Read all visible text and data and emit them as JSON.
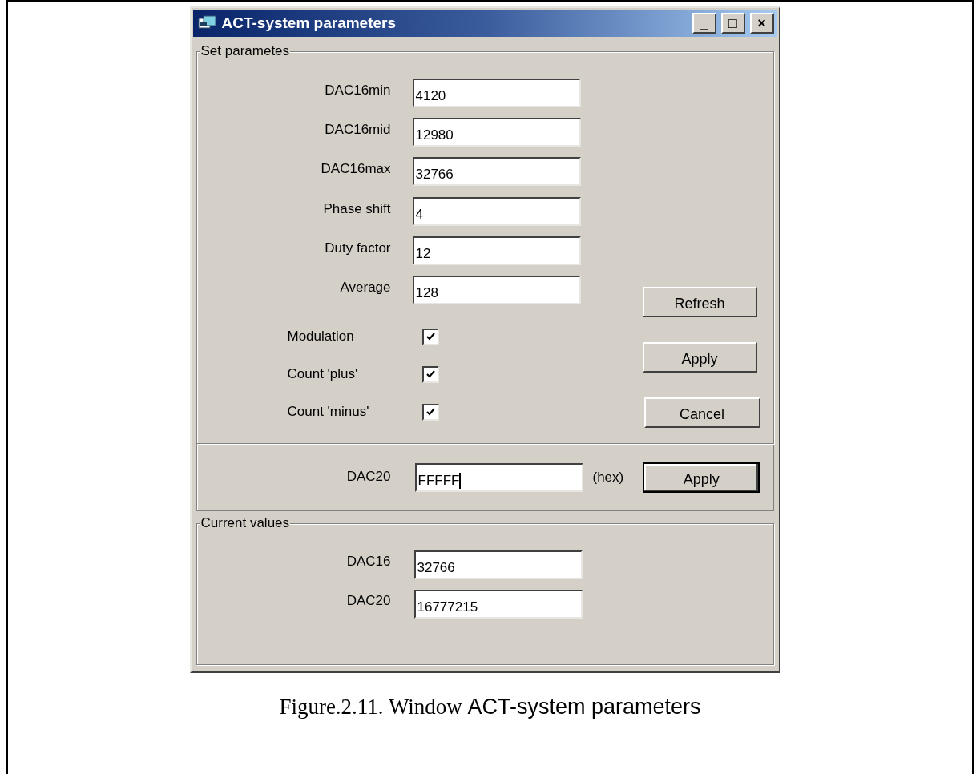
{
  "window": {
    "title": "ACT-system parameters",
    "controls": [
      "_",
      "□",
      "×"
    ]
  },
  "set_group": {
    "title": "Set parametes",
    "fields": [
      {
        "label": "DAC16min",
        "value": "4120"
      },
      {
        "label": "DAC16mid",
        "value": "12980"
      },
      {
        "label": "DAC16max",
        "value": "32766"
      },
      {
        "label": "Phase shift",
        "value": "4"
      },
      {
        "label": "Duty factor",
        "value": "12"
      },
      {
        "label": "Average",
        "value": "128"
      }
    ],
    "checkboxes": [
      {
        "label": "Modulation",
        "checked": true
      },
      {
        "label": "Count 'plus'",
        "checked": true
      },
      {
        "label": "Count 'minus'",
        "checked": true
      }
    ],
    "buttons": [
      "Refresh",
      "Apply",
      "Cancel"
    ]
  },
  "dac20_row": {
    "label": "DAC20",
    "value": "FFFFF",
    "focused": true,
    "unit": "(hex)",
    "button": {
      "label": "Apply",
      "default": true
    }
  },
  "current_group": {
    "title": "Current values",
    "fields": [
      {
        "label": "DAC16",
        "value": "32766"
      },
      {
        "label": "DAC20",
        "value": "16777215"
      }
    ]
  },
  "caption": {
    "prefix": "Figure.2.11. Window ",
    "title": "ACT-system parameters"
  }
}
